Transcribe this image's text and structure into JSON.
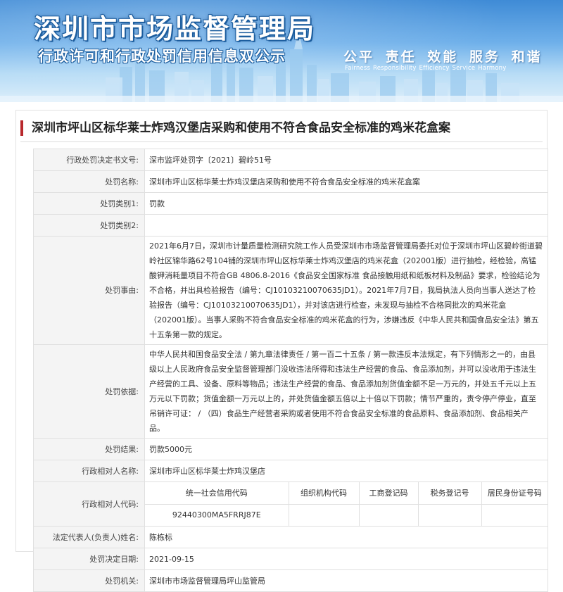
{
  "banner": {
    "title": "深圳市市场监督管理局",
    "subtitle": "行政许可和行政处罚信用信息双公示",
    "slogan": "公平  责任  效能  服务  和谐",
    "slogan_en": "Fairness  Responsibility  Efficiency  Service  Harmony",
    "colors": {
      "sky_top": "#3f8bd6",
      "sky_bottom": "#dceefa",
      "title_outline": "#1c5d9e"
    }
  },
  "case": {
    "title": "深圳市坪山区标华莱士炸鸡汉堡店采购和使用不符合食品安全标准的鸡米花盒案",
    "accent_color": "#b8282c"
  },
  "fields": {
    "decision_no": {
      "label": "行政处罚决定书文号:",
      "value": "深市监坪处罚字〔2021〕碧岭51号"
    },
    "case_name": {
      "label": "处罚名称:",
      "value": "深圳市坪山区标华莱士炸鸡汉堡店采购和使用不符合食品安全标准的鸡米花盒案"
    },
    "category1": {
      "label": "处罚类别1:",
      "value": "罚款"
    },
    "category2": {
      "label": "处罚类别2:",
      "value": ""
    },
    "reason": {
      "label": "处罚事由:",
      "value": "2021年6月7日，深圳市计量质量检测研究院工作人员受深圳市市场监督管理局委托对位于深圳市坪山区碧岭街道碧岭社区锦华路62号104铺的深圳市坪山区标华莱士炸鸡汉堡店的鸡米花盒（202001版）进行抽检，经检验，高锰酸钾消耗量项目不符合GB 4806.8-2016《食品安全国家标准 食品接触用纸和纸板材料及制品》要求，检验结论为不合格，并出具检验报告（编号：CJ10103210070635JD1）。2021年7月7日，我局执法人员向当事人送达了检验报告（编号：CJ10103210070635JD1），并对该店进行检查，未发现与抽检不合格同批次的鸡米花盒（202001版）。当事人采购不符合食品安全标准的鸡米花盒的行为，涉嫌违反《中华人民共和国食品安全法》第五十五条第一款的规定。"
    },
    "basis": {
      "label": "处罚依据:",
      "value": "中华人民共和国食品安全法 / 第九章法律责任 / 第一百二十五条 / 第一款违反本法规定，有下列情形之一的，由县级以上人民政府食品安全监督管理部门没收违法所得和违法生产经营的食品、食品添加剂，并可以没收用于违法生产经营的工具、设备、原料等物品；违法生产经营的食品、食品添加剂货值金额不足一万元的，并处五千元以上五万元以下罚款；货值金额一万元以上的，并处货值金额五倍以上十倍以下罚款；情节严重的，责令停产停业，直至吊销许可证：  /  （四）食品生产经营者采购或者使用不符合食品安全标准的食品原料、食品添加剂、食品相关产品。"
    },
    "result": {
      "label": "处罚结果:",
      "value": "罚款5000元"
    },
    "counterpart_name": {
      "label": "行政相对人名称:",
      "value": "深圳市坪山区标华莱士炸鸡汉堡店"
    },
    "counterpart_code": {
      "label": "行政相对人代码:",
      "headers": [
        "统一社会信用代码",
        "组织机构代码",
        "工商登记码",
        "税务登记号",
        "居民身份证号码"
      ],
      "values": [
        "92440300MA5FRRJ87E",
        "",
        "",
        "",
        ""
      ]
    },
    "legal_rep": {
      "label": "法定代表人(负责人)姓名:",
      "value": "陈栋标"
    },
    "decision_date": {
      "label": "处罚决定日期:",
      "value": "2021-09-15"
    },
    "authority": {
      "label": "处罚机关:",
      "value": "深圳市市场监督管理局坪山监管局"
    }
  }
}
